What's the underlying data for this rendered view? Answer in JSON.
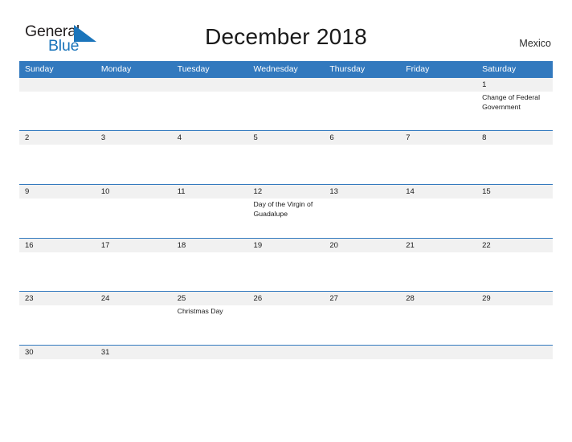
{
  "brand": {
    "word_one": "General",
    "word_two": "Blue",
    "flag_icon": "blue-flag-triangle",
    "accent_color": "#1b75bb"
  },
  "header": {
    "title": "December 2018",
    "country": "Mexico"
  },
  "theme": {
    "header_blue": "#3279be",
    "row_band_gray": "#f1f1f1",
    "text_dark": "#1a1a1a",
    "header_text": "#ffffff"
  },
  "calendar": {
    "weekdays": [
      "Sunday",
      "Monday",
      "Tuesday",
      "Wednesday",
      "Thursday",
      "Friday",
      "Saturday"
    ],
    "weeks": [
      {
        "days": [
          {
            "num": "",
            "event": ""
          },
          {
            "num": "",
            "event": ""
          },
          {
            "num": "",
            "event": ""
          },
          {
            "num": "",
            "event": ""
          },
          {
            "num": "",
            "event": ""
          },
          {
            "num": "",
            "event": ""
          },
          {
            "num": "1",
            "event": "Change of Federal Government"
          }
        ]
      },
      {
        "days": [
          {
            "num": "2",
            "event": ""
          },
          {
            "num": "3",
            "event": ""
          },
          {
            "num": "4",
            "event": ""
          },
          {
            "num": "5",
            "event": ""
          },
          {
            "num": "6",
            "event": ""
          },
          {
            "num": "7",
            "event": ""
          },
          {
            "num": "8",
            "event": ""
          }
        ]
      },
      {
        "days": [
          {
            "num": "9",
            "event": ""
          },
          {
            "num": "10",
            "event": ""
          },
          {
            "num": "11",
            "event": ""
          },
          {
            "num": "12",
            "event": "Day of the Virgin of Guadalupe"
          },
          {
            "num": "13",
            "event": ""
          },
          {
            "num": "14",
            "event": ""
          },
          {
            "num": "15",
            "event": ""
          }
        ]
      },
      {
        "days": [
          {
            "num": "16",
            "event": ""
          },
          {
            "num": "17",
            "event": ""
          },
          {
            "num": "18",
            "event": ""
          },
          {
            "num": "19",
            "event": ""
          },
          {
            "num": "20",
            "event": ""
          },
          {
            "num": "21",
            "event": ""
          },
          {
            "num": "22",
            "event": ""
          }
        ]
      },
      {
        "days": [
          {
            "num": "23",
            "event": ""
          },
          {
            "num": "24",
            "event": ""
          },
          {
            "num": "25",
            "event": "Christmas Day"
          },
          {
            "num": "26",
            "event": ""
          },
          {
            "num": "27",
            "event": ""
          },
          {
            "num": "28",
            "event": ""
          },
          {
            "num": "29",
            "event": ""
          }
        ]
      },
      {
        "days": [
          {
            "num": "30",
            "event": ""
          },
          {
            "num": "31",
            "event": ""
          },
          {
            "num": "",
            "event": ""
          },
          {
            "num": "",
            "event": ""
          },
          {
            "num": "",
            "event": ""
          },
          {
            "num": "",
            "event": ""
          },
          {
            "num": "",
            "event": ""
          }
        ]
      }
    ]
  }
}
